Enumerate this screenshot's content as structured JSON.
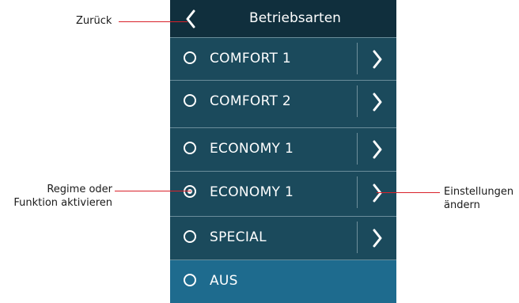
{
  "header": {
    "title": "Betriebsarten",
    "back_icon": "chevron-left-icon"
  },
  "modes": [
    {
      "label": "COMFORT 1",
      "selected": false,
      "has_settings": true
    },
    {
      "label": "COMFORT 2",
      "selected": false,
      "has_settings": true
    },
    {
      "label": "ECONOMY 1",
      "selected": false,
      "has_settings": true
    },
    {
      "label": "ECONOMY 1",
      "selected": true,
      "has_settings": true
    },
    {
      "label": "SPECIAL",
      "selected": false,
      "has_settings": true
    },
    {
      "label": "AUS",
      "selected": false,
      "has_settings": false
    }
  ],
  "annotations": {
    "back": "Zurück",
    "activate_line1": "Regime oder",
    "activate_line2": "Funktion aktivieren",
    "settings_line1": "Einstellungen",
    "settings_line2": "ändern"
  },
  "colors": {
    "header_bg": "#102f3d",
    "row_bg": "#1b4a5c",
    "aus_bg": "#1e6b8e",
    "separator": "#6a8d9a",
    "leader_line": "#d9212a",
    "text": "#ffffff"
  }
}
